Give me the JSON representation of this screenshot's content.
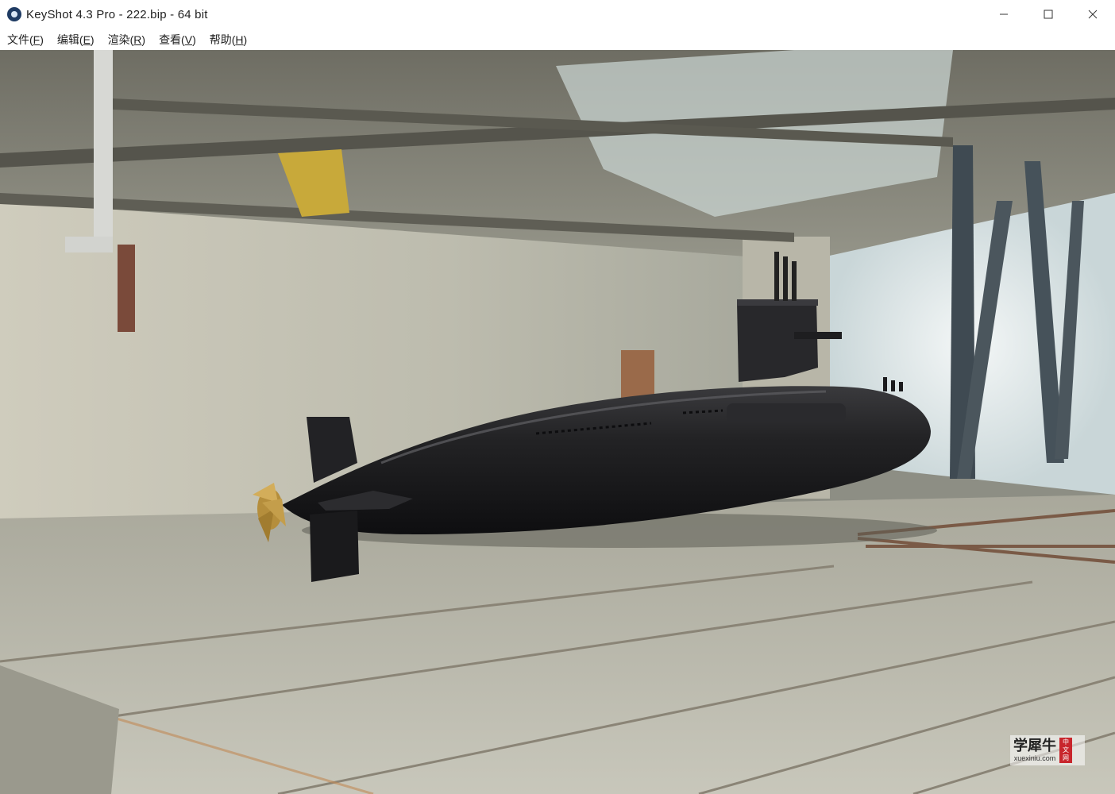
{
  "window": {
    "title": "KeyShot 4.3 Pro  - 222.bip  - 64 bit",
    "controls": {
      "minimize_icon": "minimize-icon",
      "maximize_icon": "maximize-icon",
      "close_icon": "close-icon"
    }
  },
  "menu": {
    "items": [
      {
        "label": "文件(",
        "accel": "F",
        "close": ")"
      },
      {
        "label": "编辑(",
        "accel": "E",
        "close": ")"
      },
      {
        "label": "渲染(",
        "accel": "R",
        "close": ")"
      },
      {
        "label": "查看(",
        "accel": "V",
        "close": ")"
      },
      {
        "label": "帮助(",
        "accel": "H",
        "close": ")"
      }
    ]
  },
  "viewport": {
    "content": "render-view",
    "colors": {
      "submarine": "#1b1b1d",
      "floor": "#b7b6a8",
      "wall": "#c9c6b6"
    }
  },
  "watermark": {
    "title": "学犀牛",
    "url": "xuexiniu.com",
    "seal": [
      "中",
      "文",
      "网"
    ]
  }
}
